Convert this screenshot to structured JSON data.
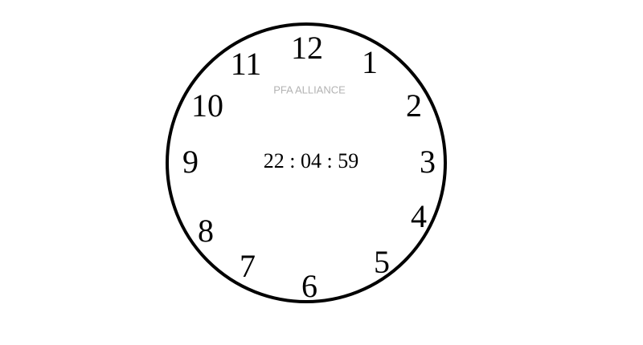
{
  "clock": {
    "brand": "PFA ALLIANCE",
    "digital_time": "22 : 04 : 59",
    "numerals": [
      "12",
      "1",
      "2",
      "3",
      "4",
      "5",
      "6",
      "7",
      "8",
      "9",
      "10",
      "11"
    ]
  },
  "colors": {
    "face_border": "#000000",
    "numeral": "#000000",
    "brand_text": "#b3b3b3",
    "background": "#ffffff"
  }
}
